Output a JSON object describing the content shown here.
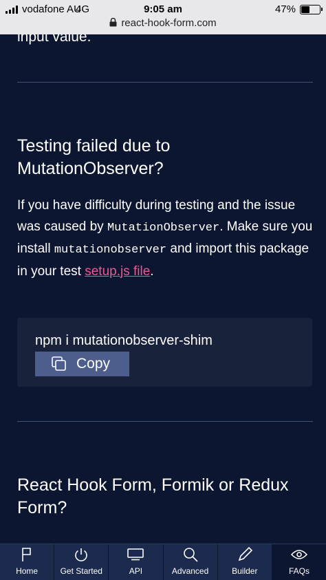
{
  "status_bar": {
    "carrier": "vodafone AU",
    "network": "4G",
    "time": "9:05 am",
    "battery": "47%",
    "battery_level": 0.47,
    "url": "react-hook-form.com"
  },
  "content": {
    "cut_text": "input value.",
    "section1": {
      "heading_line1": "Testing failed due to",
      "heading_line2": "MutationObserver?",
      "p_1": "If you have difficulty during testing and the issue was caused by ",
      "code_1": "MutationObserver",
      "p_2": ". Make sure you install ",
      "code_2": "mutationobserver",
      "p_3": " and import this package in your test ",
      "link": "setup.js file",
      "p_4": "."
    },
    "code_block": {
      "command": "npm i mutationobserver-shim",
      "copy_label": "Copy"
    },
    "section2": {
      "heading_line1": "React Hook Form, Formik or Redux",
      "heading_line2": "Form?"
    }
  },
  "tabbar": {
    "tabs": [
      {
        "label": "Home",
        "icon": "flag-icon"
      },
      {
        "label": "Get Started",
        "icon": "power-icon"
      },
      {
        "label": "API",
        "icon": "monitor-icon"
      },
      {
        "label": "Advanced",
        "icon": "search-icon"
      },
      {
        "label": "Builder",
        "icon": "pencil-icon"
      },
      {
        "label": "FAQs",
        "icon": "eye-icon"
      }
    ],
    "active_index": 5
  },
  "colors": {
    "background": "#0d1630",
    "code_box": "#18223a",
    "copy_button": "#4d5d8c",
    "link": "#ec5990",
    "tabbar": "#1b2a4d",
    "divider": "#3f5478"
  }
}
